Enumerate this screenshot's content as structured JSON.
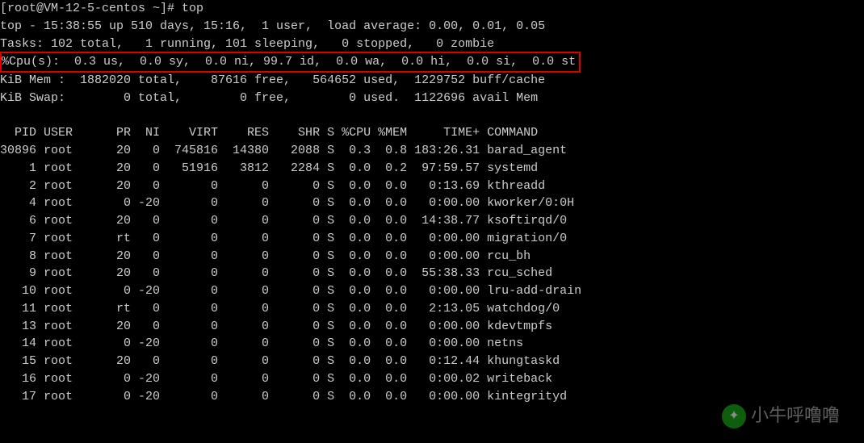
{
  "prompt": "[root@VM-12-5-centos ~]# ",
  "command": "top",
  "summary": {
    "timeLine": "top - 15:38:55 up 510 days, 15:16,  1 user,  load average: 0.00, 0.01, 0.05",
    "tasksLine": "Tasks: 102 total,   1 running, 101 sleeping,   0 stopped,   0 zombie",
    "cpuLine": "%Cpu(s):  0.3 us,  0.0 sy,  0.0 ni, 99.7 id,  0.0 wa,  0.0 hi,  0.0 si,  0.0 st",
    "memLine": "KiB Mem :  1882020 total,    87616 free,   564652 used,  1229752 buff/cache",
    "swapLine": "KiB Swap:        0 total,        0 free,        0 used.  1122696 avail Mem"
  },
  "columns": "  PID USER      PR  NI    VIRT    RES    SHR S %CPU %MEM     TIME+ COMMAND",
  "processes": [
    {
      "pid": 30896,
      "user": "root",
      "pr": "20",
      "ni": "0",
      "virt": "745816",
      "res": "14380",
      "shr": "2088",
      "s": "S",
      "cpu": "0.3",
      "mem": "0.8",
      "time": "183:26.31",
      "cmd": "barad_agent"
    },
    {
      "pid": 1,
      "user": "root",
      "pr": "20",
      "ni": "0",
      "virt": "51916",
      "res": "3812",
      "shr": "2284",
      "s": "S",
      "cpu": "0.0",
      "mem": "0.2",
      "time": "97:59.57",
      "cmd": "systemd"
    },
    {
      "pid": 2,
      "user": "root",
      "pr": "20",
      "ni": "0",
      "virt": "0",
      "res": "0",
      "shr": "0",
      "s": "S",
      "cpu": "0.0",
      "mem": "0.0",
      "time": "0:13.69",
      "cmd": "kthreadd"
    },
    {
      "pid": 4,
      "user": "root",
      "pr": "0",
      "ni": "-20",
      "virt": "0",
      "res": "0",
      "shr": "0",
      "s": "S",
      "cpu": "0.0",
      "mem": "0.0",
      "time": "0:00.00",
      "cmd": "kworker/0:0H"
    },
    {
      "pid": 6,
      "user": "root",
      "pr": "20",
      "ni": "0",
      "virt": "0",
      "res": "0",
      "shr": "0",
      "s": "S",
      "cpu": "0.0",
      "mem": "0.0",
      "time": "14:38.77",
      "cmd": "ksoftirqd/0"
    },
    {
      "pid": 7,
      "user": "root",
      "pr": "rt",
      "ni": "0",
      "virt": "0",
      "res": "0",
      "shr": "0",
      "s": "S",
      "cpu": "0.0",
      "mem": "0.0",
      "time": "0:00.00",
      "cmd": "migration/0"
    },
    {
      "pid": 8,
      "user": "root",
      "pr": "20",
      "ni": "0",
      "virt": "0",
      "res": "0",
      "shr": "0",
      "s": "S",
      "cpu": "0.0",
      "mem": "0.0",
      "time": "0:00.00",
      "cmd": "rcu_bh"
    },
    {
      "pid": 9,
      "user": "root",
      "pr": "20",
      "ni": "0",
      "virt": "0",
      "res": "0",
      "shr": "0",
      "s": "S",
      "cpu": "0.0",
      "mem": "0.0",
      "time": "55:38.33",
      "cmd": "rcu_sched"
    },
    {
      "pid": 10,
      "user": "root",
      "pr": "0",
      "ni": "-20",
      "virt": "0",
      "res": "0",
      "shr": "0",
      "s": "S",
      "cpu": "0.0",
      "mem": "0.0",
      "time": "0:00.00",
      "cmd": "lru-add-drain"
    },
    {
      "pid": 11,
      "user": "root",
      "pr": "rt",
      "ni": "0",
      "virt": "0",
      "res": "0",
      "shr": "0",
      "s": "S",
      "cpu": "0.0",
      "mem": "0.0",
      "time": "2:13.05",
      "cmd": "watchdog/0"
    },
    {
      "pid": 13,
      "user": "root",
      "pr": "20",
      "ni": "0",
      "virt": "0",
      "res": "0",
      "shr": "0",
      "s": "S",
      "cpu": "0.0",
      "mem": "0.0",
      "time": "0:00.00",
      "cmd": "kdevtmpfs"
    },
    {
      "pid": 14,
      "user": "root",
      "pr": "0",
      "ni": "-20",
      "virt": "0",
      "res": "0",
      "shr": "0",
      "s": "S",
      "cpu": "0.0",
      "mem": "0.0",
      "time": "0:00.00",
      "cmd": "netns"
    },
    {
      "pid": 15,
      "user": "root",
      "pr": "20",
      "ni": "0",
      "virt": "0",
      "res": "0",
      "shr": "0",
      "s": "S",
      "cpu": "0.0",
      "mem": "0.0",
      "time": "0:12.44",
      "cmd": "khungtaskd"
    },
    {
      "pid": 16,
      "user": "root",
      "pr": "0",
      "ni": "-20",
      "virt": "0",
      "res": "0",
      "shr": "0",
      "s": "S",
      "cpu": "0.0",
      "mem": "0.0",
      "time": "0:00.02",
      "cmd": "writeback"
    },
    {
      "pid": 17,
      "user": "root",
      "pr": "0",
      "ni": "-20",
      "virt": "0",
      "res": "0",
      "shr": "0",
      "s": "S",
      "cpu": "0.0",
      "mem": "0.0",
      "time": "0:00.00",
      "cmd": "kintegrityd"
    }
  ],
  "watermark": "小牛呼噜噜"
}
